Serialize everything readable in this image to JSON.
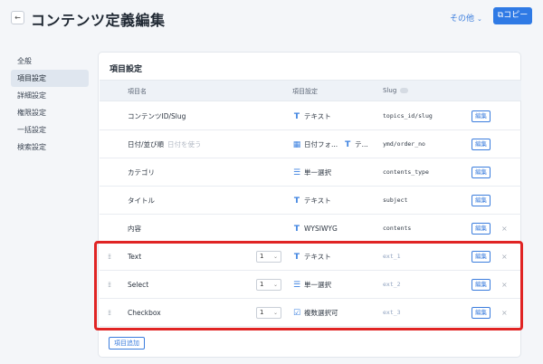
{
  "header": {
    "back_icon": "arrow-left-icon",
    "title": "コンテンツ定義編集",
    "other_menu": "その他",
    "copy_label": "コピー",
    "accent_color": "#2f7ae5"
  },
  "sidebar": {
    "items": [
      {
        "label": "全般",
        "active": false
      },
      {
        "label": "項目設定",
        "active": true
      },
      {
        "label": "詳細設定",
        "active": false
      },
      {
        "label": "権限設定",
        "active": false
      },
      {
        "label": "一括設定",
        "active": false
      },
      {
        "label": "検索設定",
        "active": false
      }
    ]
  },
  "panel": {
    "title": "項目設定",
    "columns": {
      "name": "項目名",
      "setting": "項目設定",
      "slug": "Slug"
    },
    "rows": [
      {
        "name": "コンテンツID/Slug",
        "placeholder": "",
        "type": "テキスト",
        "type2": "",
        "slug": "topics_id/slug",
        "edit": "編集",
        "deletable": false,
        "custom": false
      },
      {
        "name": "日付/並び順",
        "placeholder": "日付を使う",
        "type": "日付フォ...",
        "type2": "テ...",
        "slug": "ymd/order_no",
        "edit": "編集",
        "deletable": false,
        "custom": false
      },
      {
        "name": "カテゴリ",
        "placeholder": "",
        "type": "単一選択",
        "type2": "",
        "slug": "contents_type",
        "edit": "編集",
        "deletable": false,
        "custom": false
      },
      {
        "name": "タイトル",
        "placeholder": "",
        "type": "テキスト",
        "type2": "",
        "slug": "subject",
        "edit": "編集",
        "deletable": false,
        "custom": false
      },
      {
        "name": "内容",
        "placeholder": "",
        "type": "WYSIWYG",
        "type2": "",
        "slug": "contents",
        "edit": "編集",
        "deletable": true,
        "custom": false
      },
      {
        "name": "Text",
        "placeholder": "",
        "count": "1",
        "type": "テキスト",
        "type2": "",
        "slug": "ext_1",
        "edit": "編集",
        "deletable": true,
        "custom": true
      },
      {
        "name": "Select",
        "placeholder": "",
        "count": "1",
        "type": "単一選択",
        "type2": "",
        "slug": "ext_2",
        "edit": "編集",
        "deletable": true,
        "custom": true
      },
      {
        "name": "Checkbox",
        "placeholder": "",
        "count": "1",
        "type": "複数選択可",
        "type2": "",
        "slug": "ext_3",
        "edit": "編集",
        "deletable": true,
        "custom": true
      }
    ],
    "add_label": "項目追加"
  }
}
